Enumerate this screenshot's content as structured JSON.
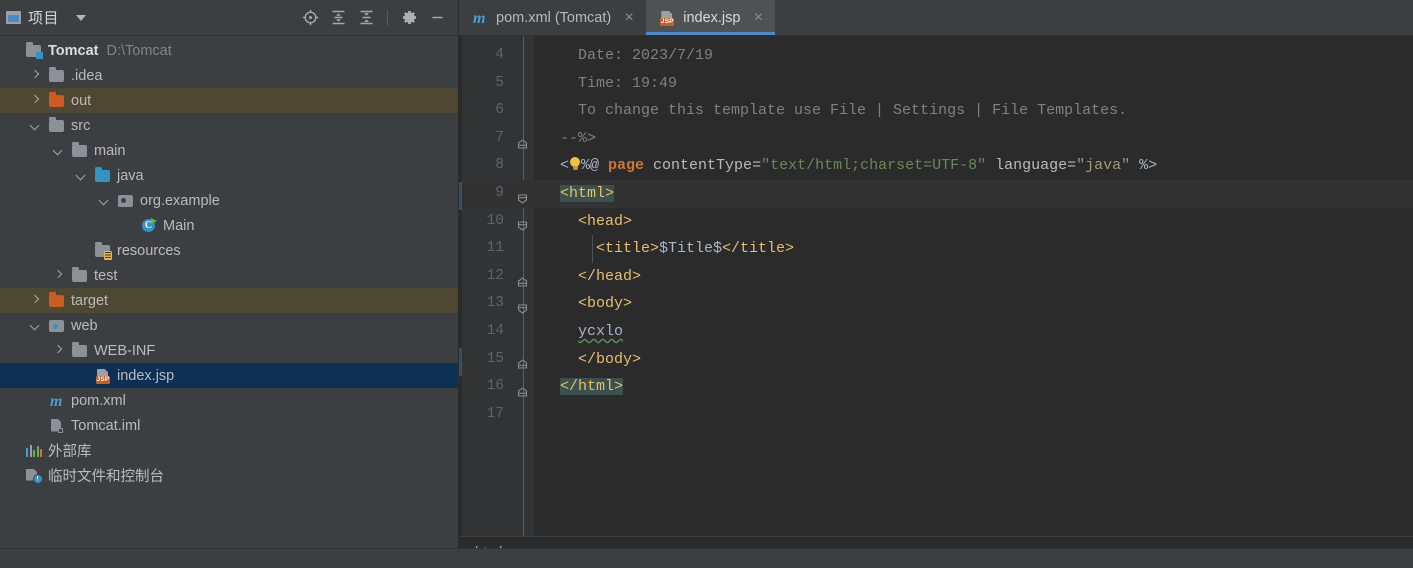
{
  "project_panel": {
    "title": "项目",
    "window_icon": "project-window-icon",
    "dropdown_icon": "chevron-down-icon",
    "toolbar": [
      {
        "name": "locate-icon",
        "label": "Select Opened File"
      },
      {
        "name": "expand-all-icon",
        "label": "Expand All"
      },
      {
        "name": "collapse-all-icon",
        "label": "Collapse All"
      },
      {
        "name": "gear-icon",
        "label": "Settings"
      },
      {
        "name": "minimize-icon",
        "label": "Hide"
      }
    ],
    "tree": [
      {
        "label": "Tomcat",
        "secondary": "D:\\Tomcat",
        "icon": "module-icon",
        "indent": 0,
        "arrow": "none",
        "bold": true,
        "state": "normal"
      },
      {
        "label": ".idea",
        "icon": "folder-gray-icon",
        "indent": 1,
        "arrow": "right",
        "state": "normal"
      },
      {
        "label": "out",
        "icon": "folder-orange-icon",
        "indent": 1,
        "arrow": "right",
        "state": "excluded-highlight"
      },
      {
        "label": "src",
        "icon": "folder-gray-icon",
        "indent": 1,
        "arrow": "down",
        "state": "normal"
      },
      {
        "label": "main",
        "icon": "folder-gray-icon",
        "indent": 2,
        "arrow": "down",
        "state": "normal"
      },
      {
        "label": "java",
        "icon": "folder-source-blue-icon",
        "indent": 3,
        "arrow": "down",
        "state": "normal"
      },
      {
        "label": "org.example",
        "icon": "package-icon",
        "indent": 4,
        "arrow": "down",
        "state": "normal"
      },
      {
        "label": "Main",
        "icon": "java-class-runnable-icon",
        "indent": 5,
        "arrow": "none",
        "state": "normal"
      },
      {
        "label": "resources",
        "icon": "folder-resources-icon",
        "indent": 3,
        "arrow": "none",
        "state": "normal"
      },
      {
        "label": "test",
        "icon": "folder-gray-icon",
        "indent": 2,
        "arrow": "right",
        "state": "normal"
      },
      {
        "label": "target",
        "icon": "folder-orange-icon",
        "indent": 1,
        "arrow": "right",
        "state": "excluded-highlight"
      },
      {
        "label": "web",
        "icon": "web-module-icon",
        "indent": 1,
        "arrow": "down",
        "state": "normal"
      },
      {
        "label": "WEB-INF",
        "icon": "folder-gray-icon",
        "indent": 2,
        "arrow": "right",
        "state": "normal"
      },
      {
        "label": "index.jsp",
        "icon": "jsp-file-icon",
        "indent": 3,
        "arrow": "none",
        "state": "selected"
      },
      {
        "label": "pom.xml",
        "icon": "maven-icon",
        "indent": 1,
        "arrow": "none",
        "state": "normal"
      },
      {
        "label": "Tomcat.iml",
        "icon": "iml-file-icon",
        "indent": 1,
        "arrow": "none",
        "state": "normal"
      },
      {
        "label": "外部库",
        "icon": "external-libraries-icon",
        "indent": 0,
        "arrow": "none",
        "state": "normal"
      },
      {
        "label": "临时文件和控制台",
        "icon": "scratches-consoles-icon",
        "indent": 0,
        "arrow": "none",
        "state": "normal"
      }
    ]
  },
  "editor": {
    "tabs": [
      {
        "label": "pom.xml (Tomcat)",
        "icon": "maven-icon",
        "active": false,
        "close_icon": "close-icon"
      },
      {
        "label": "index.jsp",
        "icon": "jsp-file-icon",
        "active": true,
        "close_icon": "close-icon"
      }
    ],
    "line_numbers": [
      "4",
      "5",
      "6",
      "7",
      "8",
      "9",
      "10",
      "11",
      "12",
      "13",
      "14",
      "15",
      "16",
      "17"
    ],
    "caret_line": "9",
    "lines": [
      {
        "num": "4",
        "indent_guide": false,
        "fold": "none",
        "tokens": [
          {
            "t": "comment",
            "s": "    Date: 2023/7/19"
          }
        ]
      },
      {
        "num": "5",
        "indent_guide": false,
        "fold": "none",
        "tokens": [
          {
            "t": "comment",
            "s": "    Time: 19:49"
          }
        ]
      },
      {
        "num": "6",
        "indent_guide": false,
        "fold": "none",
        "tokens": [
          {
            "t": "comment",
            "s": "    To change this template use File | Settings | File Templates."
          }
        ]
      },
      {
        "num": "7",
        "indent_guide": false,
        "fold": "end",
        "tokens": [
          {
            "t": "comment",
            "s": "  --%>"
          }
        ]
      },
      {
        "num": "8",
        "indent_guide": false,
        "fold": "none",
        "tokens": [
          {
            "t": "punct",
            "s": "  <"
          },
          {
            "t": "bulb",
            "s": ""
          },
          {
            "t": "punct",
            "s": "%@ "
          },
          {
            "t": "keyword",
            "s": "page "
          },
          {
            "t": "attr",
            "s": "contentType="
          },
          {
            "t": "string",
            "s": "\"text/html;charset=UTF-8\""
          },
          {
            "t": "attr",
            "s": " language="
          },
          {
            "t": "strjava",
            "s": "\"java\""
          },
          {
            "t": "punct",
            "s": " %>"
          }
        ]
      },
      {
        "num": "9",
        "indent_guide": false,
        "fold": "start",
        "caret": true,
        "tokens": [
          {
            "t": "plain",
            "s": "  "
          },
          {
            "t": "tag-highlight",
            "s": "<html>"
          }
        ]
      },
      {
        "num": "10",
        "indent_guide": false,
        "fold": "start",
        "tokens": [
          {
            "t": "tag",
            "s": "    <head>"
          }
        ]
      },
      {
        "num": "11",
        "indent_guide": true,
        "fold": "none",
        "tokens": [
          {
            "t": "tag",
            "s": "      <title>"
          },
          {
            "t": "plain",
            "s": "$Title$"
          },
          {
            "t": "tag",
            "s": "</title>"
          }
        ]
      },
      {
        "num": "12",
        "indent_guide": false,
        "fold": "end",
        "tokens": [
          {
            "t": "tag",
            "s": "    </head>"
          }
        ]
      },
      {
        "num": "13",
        "indent_guide": false,
        "fold": "start",
        "tokens": [
          {
            "t": "tag",
            "s": "    <body>"
          }
        ]
      },
      {
        "num": "14",
        "indent_guide": false,
        "fold": "none",
        "tokens": [
          {
            "t": "plain",
            "s": "    "
          },
          {
            "t": "spell",
            "s": "ycxlo"
          }
        ]
      },
      {
        "num": "15",
        "indent_guide": false,
        "fold": "end",
        "tokens": [
          {
            "t": "tag",
            "s": "    </body>"
          }
        ]
      },
      {
        "num": "16",
        "indent_guide": false,
        "fold": "end",
        "tokens": [
          {
            "t": "plain",
            "s": "  "
          },
          {
            "t": "tag-highlight",
            "s": "</html>"
          }
        ]
      },
      {
        "num": "17",
        "indent_guide": false,
        "fold": "none",
        "tokens": [
          {
            "t": "plain",
            "s": ""
          }
        ]
      }
    ],
    "breadcrumb": "html"
  },
  "colors": {
    "panel_bg": "#3c3f41",
    "editor_bg": "#2b2b2b",
    "gutter_bg": "#313335",
    "selection_blue": "#0d3054",
    "excluded_brown": "#4e4833",
    "tab_active_bg": "#4e5254",
    "tab_underline": "#4a88c7",
    "caret_line": "#323232",
    "match_highlight": "#3b514d",
    "tag_color": "#e8bf6a",
    "keyword_color": "#cc7832",
    "string_color": "#6a8759",
    "comment_color": "#808080",
    "text_color": "#a9b7c6"
  }
}
